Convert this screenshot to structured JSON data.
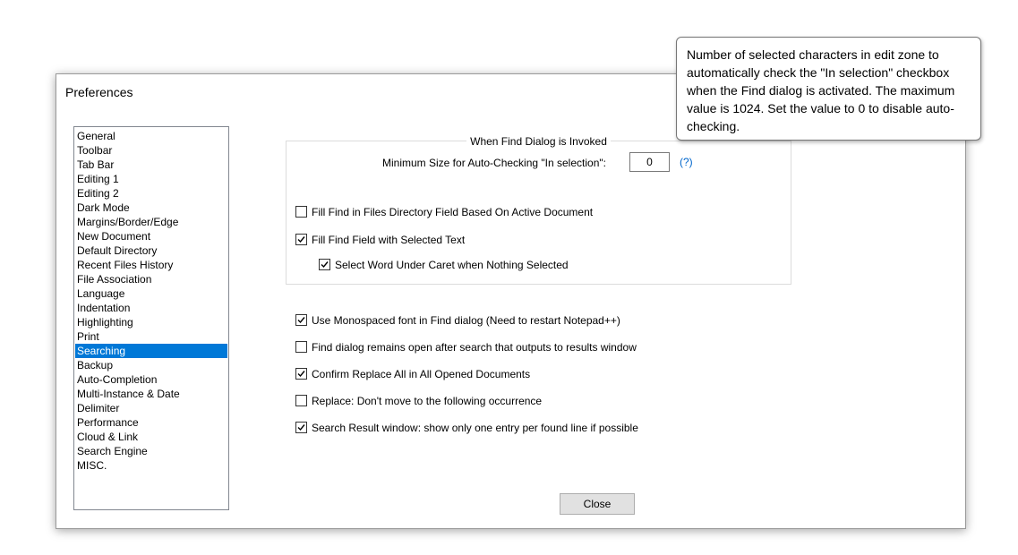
{
  "dialog": {
    "title": "Preferences"
  },
  "categories": [
    {
      "label": "General",
      "selected": false
    },
    {
      "label": "Toolbar",
      "selected": false
    },
    {
      "label": "Tab Bar",
      "selected": false
    },
    {
      "label": "Editing 1",
      "selected": false
    },
    {
      "label": "Editing 2",
      "selected": false
    },
    {
      "label": "Dark Mode",
      "selected": false
    },
    {
      "label": "Margins/Border/Edge",
      "selected": false
    },
    {
      "label": "New Document",
      "selected": false
    },
    {
      "label": "Default Directory",
      "selected": false
    },
    {
      "label": "Recent Files History",
      "selected": false
    },
    {
      "label": "File Association",
      "selected": false
    },
    {
      "label": "Language",
      "selected": false
    },
    {
      "label": "Indentation",
      "selected": false
    },
    {
      "label": "Highlighting",
      "selected": false
    },
    {
      "label": "Print",
      "selected": false
    },
    {
      "label": "Searching",
      "selected": true
    },
    {
      "label": "Backup",
      "selected": false
    },
    {
      "label": "Auto-Completion",
      "selected": false
    },
    {
      "label": "Multi-Instance & Date",
      "selected": false
    },
    {
      "label": "Delimiter",
      "selected": false
    },
    {
      "label": "Performance",
      "selected": false
    },
    {
      "label": "Cloud & Link",
      "selected": false
    },
    {
      "label": "Search Engine",
      "selected": false
    },
    {
      "label": "MISC.",
      "selected": false
    }
  ],
  "find_group": {
    "title": "When Find Dialog is Invoked",
    "min_size_label": "Minimum Size for Auto-Checking \"In selection\":",
    "min_size_value": "0",
    "help_link": "(?)",
    "fill_dir": {
      "label": "Fill Find in Files Directory Field Based On Active Document",
      "checked": false
    },
    "fill_find": {
      "label": "Fill Find Field with Selected Text",
      "checked": true
    },
    "select_word": {
      "label": "Select Word Under Caret when Nothing Selected",
      "checked": true
    }
  },
  "options": {
    "monospaced": {
      "label": "Use Monospaced font in Find dialog (Need to restart Notepad++)",
      "checked": true
    },
    "remains_open": {
      "label": "Find dialog remains open after search that outputs to results window",
      "checked": false
    },
    "confirm_replace": {
      "label": "Confirm Replace All in All Opened Documents",
      "checked": true
    },
    "replace_nomove": {
      "label": "Replace: Don't move to the following occurrence",
      "checked": false
    },
    "one_entry": {
      "label": "Search Result window: show only one entry per found line if possible",
      "checked": true
    }
  },
  "close_label": "Close",
  "tooltip": "Number of selected characters in edit zone to automatically check the \"In selection\" checkbox when the Find dialog is activated. The maximum value is 1024. Set the value to 0 to disable auto-checking."
}
